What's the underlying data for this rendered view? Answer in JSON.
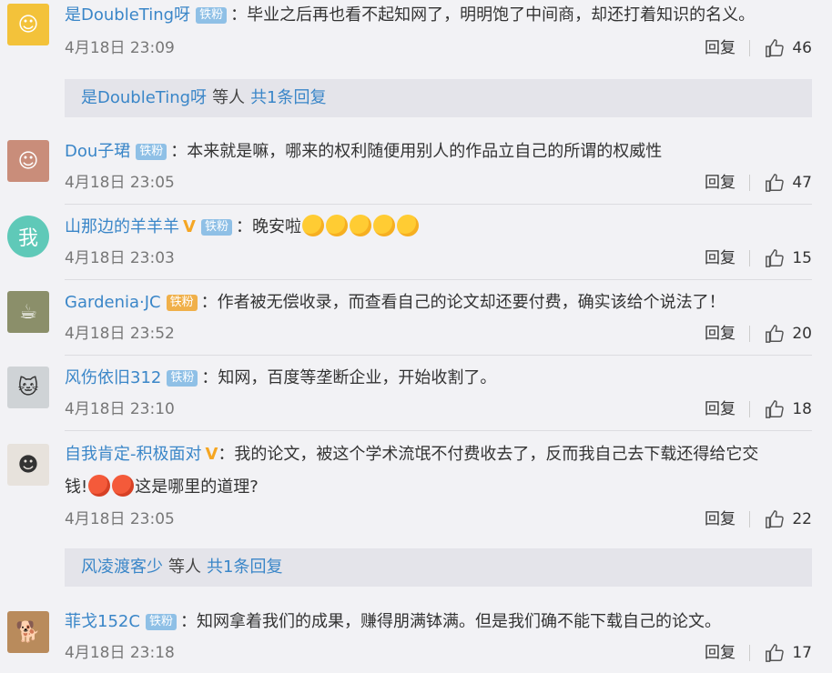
{
  "comments": [
    {
      "user": "是DoubleTing呀",
      "badge": "铁粉",
      "text": "：毕业之后再也看不起知网了，明明饱了中间商，却还打着知识的名义。",
      "time": "4月18日 23:09",
      "reply": "回复",
      "likes": "46"
    },
    {
      "user": "Dou子珺",
      "badge": "铁粉",
      "text": "：本来就是嘛，哪来的权利随便用别人的作品立自己的所谓的权威性",
      "time": "4月18日 23:05",
      "reply": "回复",
      "likes": "47"
    },
    {
      "user": "山那边的羊羊羊",
      "badge": "铁粉",
      "text": "：晚安啦",
      "time": "4月18日 23:03",
      "reply": "回复",
      "likes": "15"
    },
    {
      "user": "Gardenia·JC",
      "badge": "铁粉",
      "text": "：作者被无偿收录，而查看自己的论文却还要付费，确实该给个说法了！",
      "time": "4月18日 23:52",
      "reply": "回复",
      "likes": "20"
    },
    {
      "user": "风伤依旧312",
      "badge": "铁粉",
      "text": "：知网，百度等垄断企业，开始收割了。",
      "time": "4月18日 23:10",
      "reply": "回复",
      "likes": "18"
    },
    {
      "user": "自我肯定-积极面对",
      "text": "：我的论文，被这个学术流氓不付费收去了，反而我自己去下载还得给它交",
      "text2a": "钱!",
      "text2b": "这是哪里的道理?",
      "time": "4月18日 23:05",
      "reply": "回复",
      "likes": "22"
    },
    {
      "user": "菲戈152C",
      "badge": "铁粉",
      "text": "：知网拿着我们的成果，赚得朋满钵满。但是我们确不能下载自己的论文。",
      "time": "4月18日 23:18",
      "reply": "回复",
      "likes": "17"
    }
  ],
  "subreplies": [
    {
      "user": "是DoubleTing呀",
      "etc": "等人",
      "total": "共1条回复"
    },
    {
      "user": "风凌渡客少",
      "etc": "等人",
      "total": "共1条回复"
    }
  ],
  "colors": {
    "link": "#3a86c8",
    "badge": "#8fc0e6",
    "vip": "#f5a623",
    "background": "#f2f2f5"
  },
  "icons": {
    "like": "thumbs-up-icon"
  }
}
